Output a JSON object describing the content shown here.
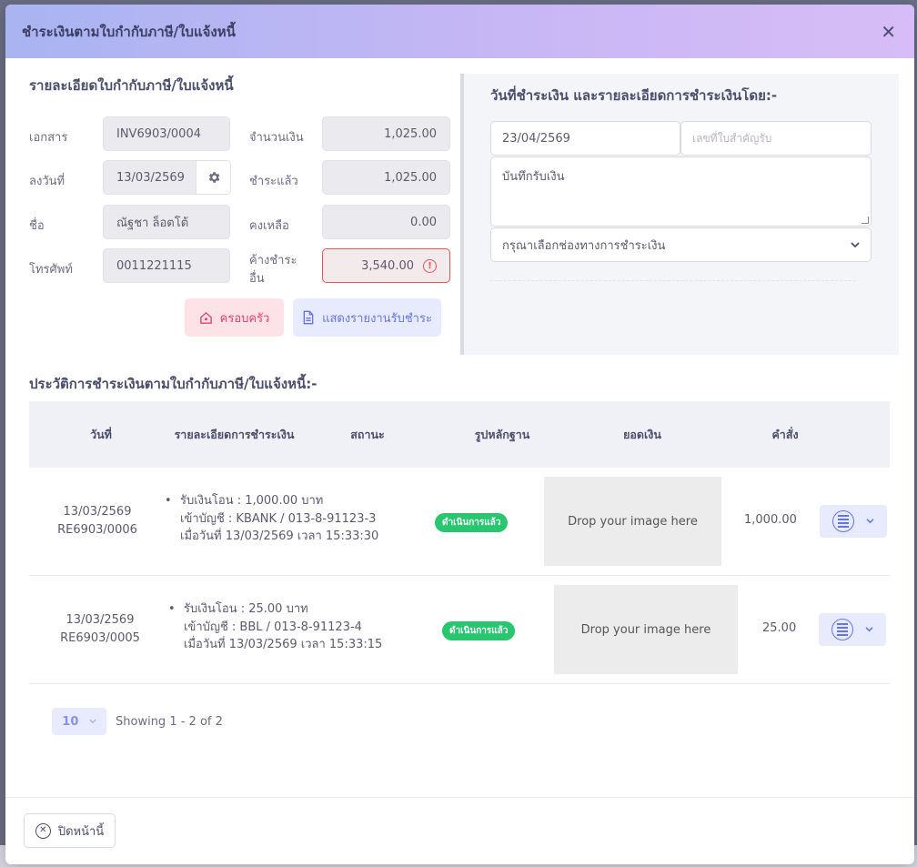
{
  "modal": {
    "title": "ชำระเงินตามใบกำกับภาษี/ใบแจ้งหนี้",
    "close_glyph": "✕"
  },
  "invoice": {
    "section_title": "รายละเอียดใบกำกับภาษี/ใบแจ้งหนี้",
    "doc_label": "เอกสาร",
    "doc_value": "INV6903/0004",
    "date_label": "ลงวันที่",
    "date_value": "13/03/2569",
    "name_label": "ชื่อ",
    "name_value": "ณัฐชา ล็อตโต้",
    "phone_label": "โทรศัพท์",
    "phone_value": "0011221115",
    "amount_label": "จำนวนเงิน",
    "amount_value": "1,025.00",
    "paid_label": "ชำระแล้ว",
    "paid_value": "1,025.00",
    "remaining_label": "คงเหลือ",
    "remaining_value": "0.00",
    "other_due_label": "ค้างชำระอื่น",
    "other_due_value": "3,540.00",
    "alert_glyph": "!",
    "family_button": "ครอบครัว",
    "report_button": "แสดงรายงานรับชำระ"
  },
  "payment": {
    "section_title": "วันที่ชำระเงิน และรายละเอียดการชำระเงินโดย:-",
    "date_value": "23/04/2569",
    "receipt_placeholder": "เลขที่ใบสำคัญรับ",
    "note_value": "บันทึกรับเงิน",
    "method_placeholder": "กรุณาเลือกช่องทางการชำระเงิน"
  },
  "history": {
    "title": "ประวัติการชำระเงินตามใบกำกับภาษี/ใบแจ้งหนี้:-",
    "columns": {
      "date": "วันที่",
      "details": "รายละเอียดการชำระเงิน",
      "status": "สถานะ",
      "evidence": "รูปหลักฐาน",
      "amount": "ยอดเงิน",
      "actions": "คำสั่ง"
    },
    "rows": [
      {
        "date": "13/03/2569",
        "receipt_no": "RE6903/0006",
        "line1": "รับเงินโอน : 1,000.00 บาท",
        "line2": "เข้าบัญชี : KBANK / 013-8-91123-3",
        "line3": "เมื่อวันที่ 13/03/2569 เวลา 15:33:30",
        "status": "ดำเนินการแล้ว",
        "dropzone": "Drop your image here",
        "amount": "1,000.00"
      },
      {
        "date": "13/03/2569",
        "receipt_no": "RE6903/0005",
        "line1": "รับเงินโอน : 25.00 บาท",
        "line2": "เข้าบัญชี : BBL / 013-8-91123-4",
        "line3": "เมื่อวันที่ 13/03/2569 เวลา 15:33:15",
        "status": "ดำเนินการแล้ว",
        "dropzone": "Drop your image here",
        "amount": "25.00"
      }
    ],
    "page_size": "10",
    "showing": "Showing 1 - 2 of 2"
  },
  "footer": {
    "close_label": "ปิดหน้านี้",
    "close_glyph": "✕"
  },
  "colors": {
    "header_gradient_start": "#a9b4f1",
    "header_gradient_end": "#d7bdf7",
    "success": "#28c76f",
    "danger": "#ea5455",
    "primary": "#6575e8"
  }
}
